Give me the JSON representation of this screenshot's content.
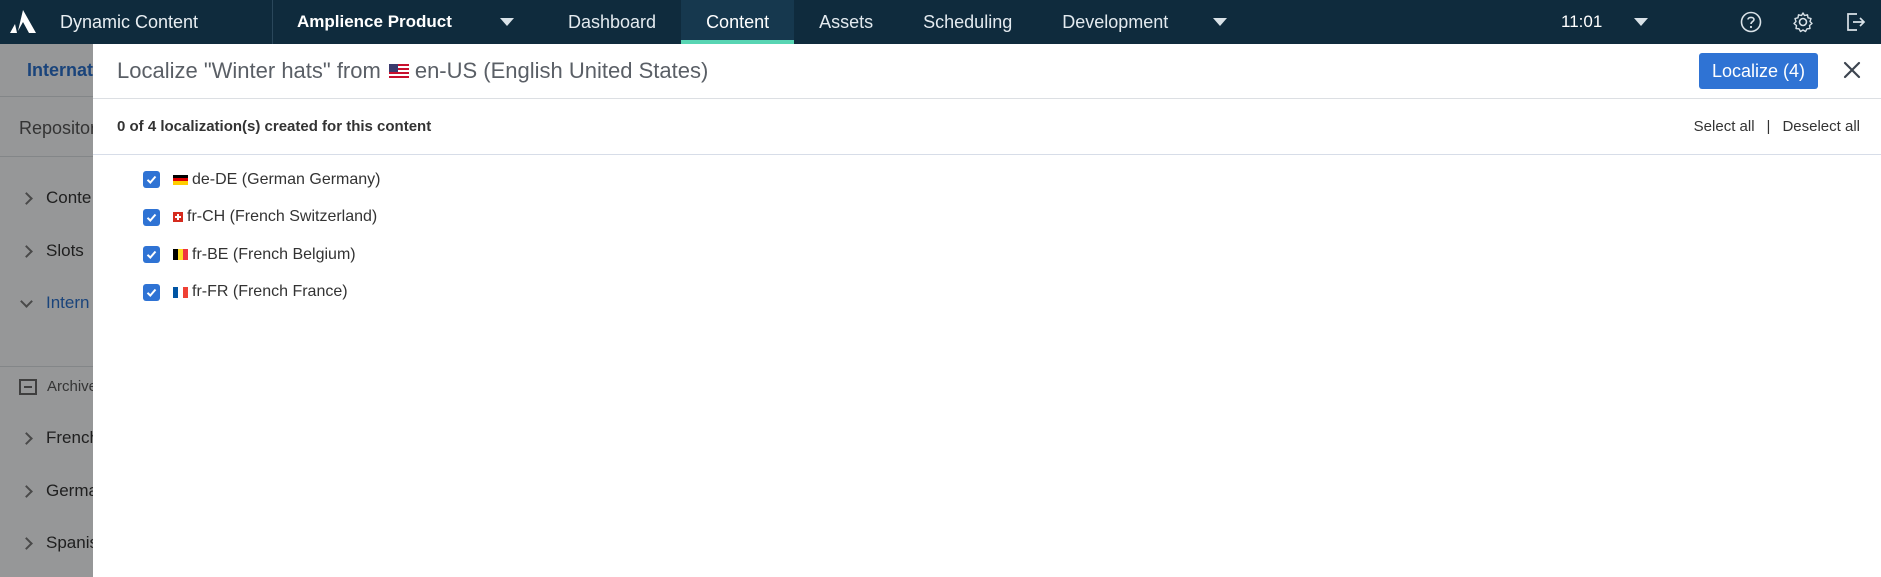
{
  "topbar": {
    "app_title": "Dynamic Content",
    "hub_name": "Amplience Product",
    "nav": [
      "Dashboard",
      "Content",
      "Assets",
      "Scheduling",
      "Development"
    ],
    "active_nav": "Content",
    "time": "11:01",
    "colors": {
      "bar": "#0f2b3d",
      "active_indicator": "#58d5b3"
    }
  },
  "background": {
    "tab": "Internat",
    "repository": "Repositor",
    "rows": [
      "Conte",
      "Slots",
      "Intern"
    ],
    "archive": "Archive",
    "folders": [
      "French",
      "Germa",
      "Spanis"
    ]
  },
  "dialog": {
    "title_prefix": "Localize \"Winter hats\" from",
    "source_locale": "en-US (English United States)",
    "source_flag_icon": "us-flag-icon",
    "localize_button": "Localize (4)",
    "summary": "0 of 4 localization(s) created for this content",
    "select_all": "Select all",
    "pipe": "|",
    "deselect_all": "Deselect all",
    "locales": [
      {
        "label": "de-DE (German Germany)",
        "checked": true,
        "flag": "de-flag-icon"
      },
      {
        "label": "fr-CH (French Switzerland)",
        "checked": true,
        "flag": "ch-flag-icon"
      },
      {
        "label": "fr-BE (French Belgium)",
        "checked": true,
        "flag": "be-flag-icon"
      },
      {
        "label": "fr-FR (French France)",
        "checked": true,
        "flag": "fr-flag-icon"
      }
    ],
    "colors": {
      "primary": "#2f73d4"
    }
  }
}
